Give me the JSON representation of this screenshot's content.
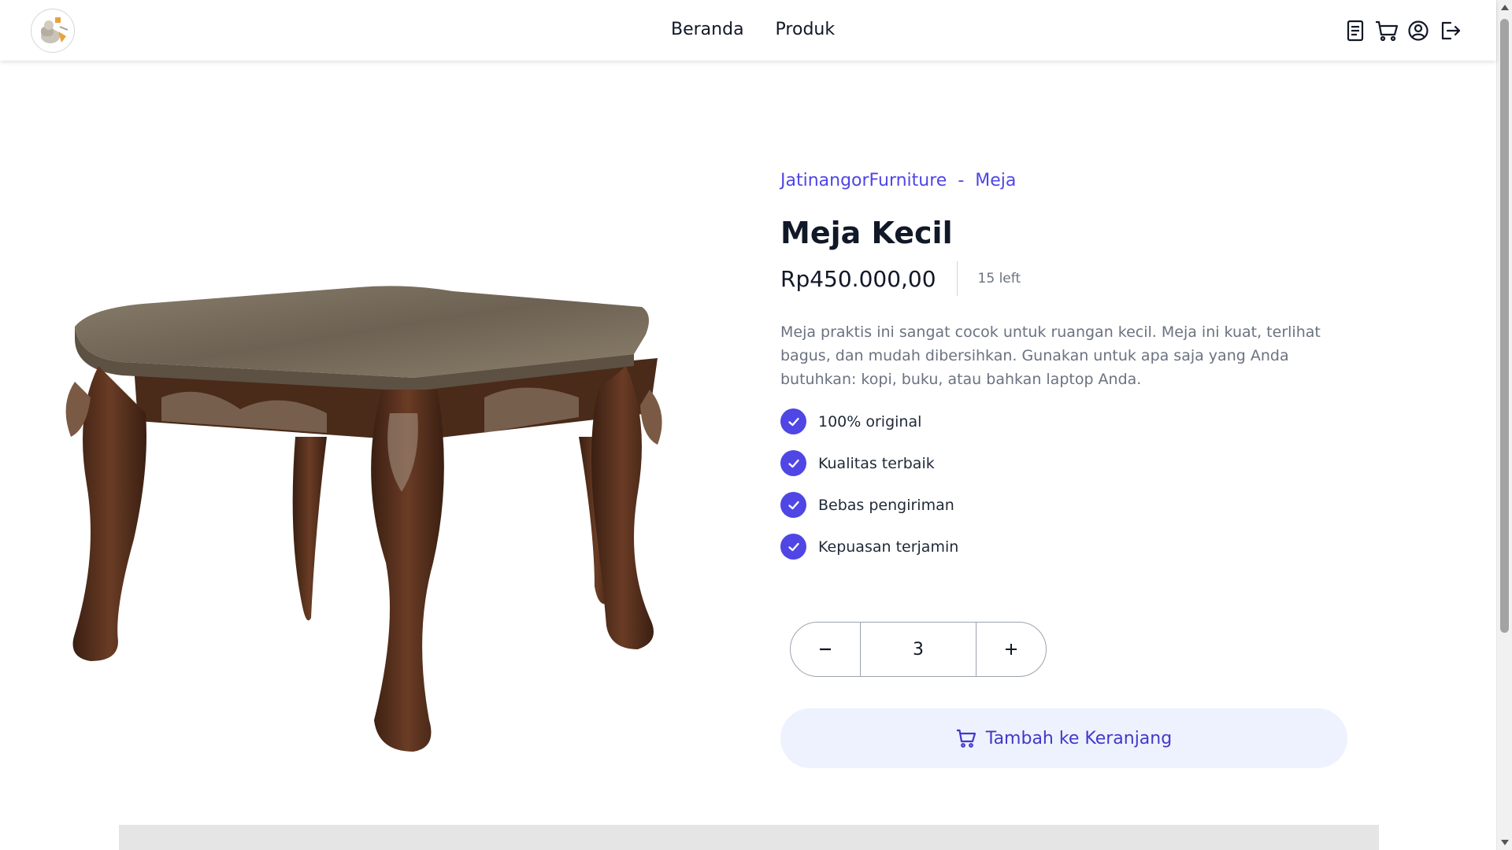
{
  "nav": {
    "links": [
      "Beranda",
      "Produk"
    ],
    "icons": [
      "document-icon",
      "cart-icon",
      "user-circle-icon",
      "logout-icon"
    ]
  },
  "breadcrumb": {
    "store": "JatinangorFurniture",
    "separator": "-",
    "category": "Meja"
  },
  "product": {
    "title": "Meja Kecil",
    "price": "Rp450.000,00",
    "stock": "15 left",
    "description": "Meja praktis ini sangat cocok untuk ruangan kecil. Meja ini kuat, terlihat bagus, dan mudah dibersihkan. Gunakan untuk apa saja yang Anda butuhkan: kopi, buku, atau bahkan laptop Anda.",
    "features": [
      "100% original",
      "Kualitas terbaik",
      "Bebas pengiriman",
      "Kepuasan terjamin"
    ]
  },
  "quantity": {
    "value": "3",
    "decrement_icon": "minus-icon",
    "increment_icon": "plus-icon"
  },
  "add_to_cart": {
    "label": "Tambah ke Keranjang",
    "icon": "cart-icon"
  },
  "colors": {
    "accent": "#4f46e5",
    "accent_dark": "#4338ca",
    "button_bg": "#eef2ff",
    "muted_text": "#6b7280"
  }
}
